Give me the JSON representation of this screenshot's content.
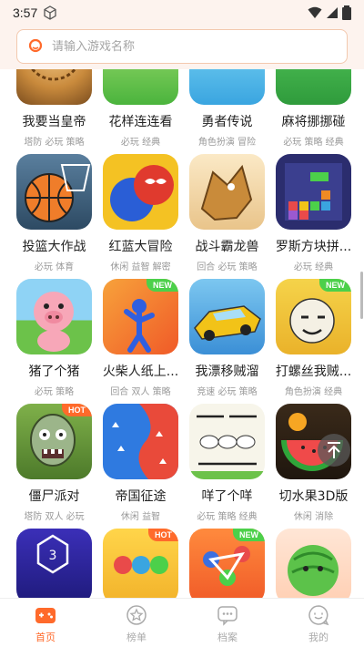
{
  "status": {
    "time": "3:57"
  },
  "search": {
    "placeholder": "请输入游戏名称"
  },
  "games": [
    {
      "name": "我要当皇帝",
      "tags": "塔防 必玩 策略",
      "badge": "",
      "icon": "emperor-game-icon"
    },
    {
      "name": "花样连连看",
      "tags": "必玩 经典",
      "badge": "",
      "icon": "mahjong-tile-icon"
    },
    {
      "name": "勇者传说",
      "tags": "角色扮演 冒险",
      "badge": "",
      "icon": "among-us-character-icon"
    },
    {
      "name": "麻将挪挪碰",
      "tags": "必玩 策略 经典",
      "badge": "",
      "icon": "mahjong-stack-icon"
    },
    {
      "name": "投篮大作战",
      "tags": "必玩 体育",
      "badge": "",
      "icon": "basketball-icon"
    },
    {
      "name": "红蓝大冒险",
      "tags": "休闲 益智 解密",
      "badge": "",
      "icon": "red-blue-heroes-icon"
    },
    {
      "name": "战斗霸龙兽",
      "tags": "回合 必玩 策略",
      "badge": "",
      "icon": "dragon-mech-icon"
    },
    {
      "name": "罗斯方块拼...",
      "tags": "必玩 经典",
      "badge": "",
      "icon": "block-puzzle-icon"
    },
    {
      "name": "猪了个猪",
      "tags": "必玩 策略",
      "badge": "",
      "icon": "pig-icon"
    },
    {
      "name": "火柴人纸上...",
      "tags": "回合 双人 策略",
      "badge": "NEW",
      "icon": "stickman-icon"
    },
    {
      "name": "我漂移贼溜",
      "tags": "竞速 必玩 策略",
      "badge": "",
      "icon": "racing-car-icon"
    },
    {
      "name": "打螺丝我贼...",
      "tags": "角色扮演 经典",
      "badge": "NEW",
      "icon": "meme-face-icon"
    },
    {
      "name": "僵尸派对",
      "tags": "塔防 双人 必玩",
      "badge": "HOT",
      "icon": "zombie-icon"
    },
    {
      "name": "帝国征途",
      "tags": "休闲 益智",
      "badge": "",
      "icon": "territory-split-icon"
    },
    {
      "name": "咩了个咩",
      "tags": "必玩 策略 经典",
      "badge": "",
      "icon": "sheep-icon"
    },
    {
      "name": "切水果3D版",
      "tags": "休闲 消除",
      "badge": "",
      "icon": "watermelon-slice-icon"
    },
    {
      "name": "",
      "tags": "",
      "badge": "",
      "icon": "number-hex-icon"
    },
    {
      "name": "",
      "tags": "",
      "badge": "HOT",
      "icon": "ball-sort-icon"
    },
    {
      "name": "",
      "tags": "",
      "badge": "NEW",
      "icon": "dots-connect-icon"
    },
    {
      "name": "",
      "tags": "",
      "badge": "",
      "icon": "watermelon-merge-icon"
    }
  ],
  "nav": [
    {
      "label": "首页",
      "active": true,
      "icon": "gamepad-home-icon"
    },
    {
      "label": "榜单",
      "active": false,
      "icon": "star-ranking-icon"
    },
    {
      "label": "档案",
      "active": false,
      "icon": "chat-archive-icon"
    },
    {
      "label": "我的",
      "active": false,
      "icon": "profile-chat-icon"
    }
  ],
  "colors": {
    "accent": "#ff6a2b",
    "new_badge": "#4cd04a",
    "hot_badge": "#ff6a2b",
    "header_bg": "#fdf3ee"
  }
}
